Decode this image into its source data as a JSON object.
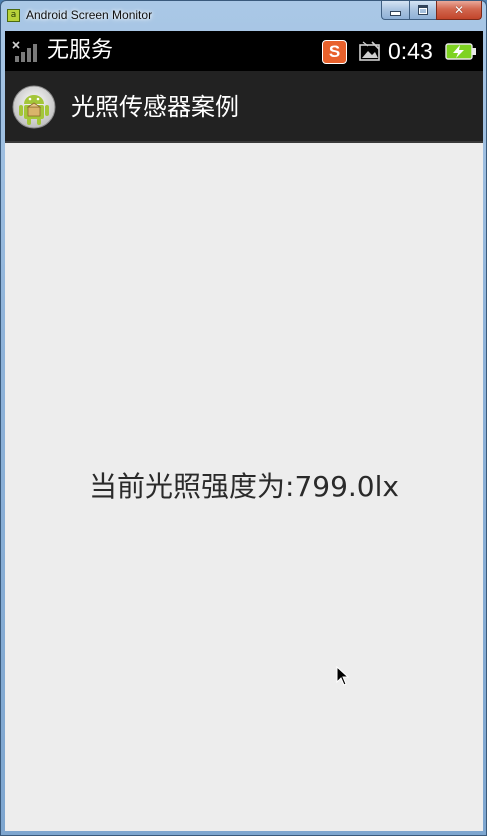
{
  "window": {
    "title": "Android Screen Monitor",
    "app_icon_glyph": "a",
    "close_glyph": "✕"
  },
  "statusbar": {
    "carrier": "无服务",
    "sogou_glyph": "S",
    "time": "0:43",
    "icons": [
      "signal-no-service-icon",
      "sogou-input-icon",
      "screenshot-icon",
      "battery-charging-icon"
    ]
  },
  "actionbar": {
    "title": "光照传感器案例",
    "icon": "android-launcher-icon"
  },
  "main": {
    "light_text": "当前光照强度为:799.0lx"
  },
  "colors": {
    "statusbar_bg": "#000000",
    "actionbar_bg": "#222222",
    "content_bg": "#ededed",
    "sogou_orange": "#e8612c",
    "battery_green": "#7ed321",
    "android_green": "#a4c639"
  }
}
